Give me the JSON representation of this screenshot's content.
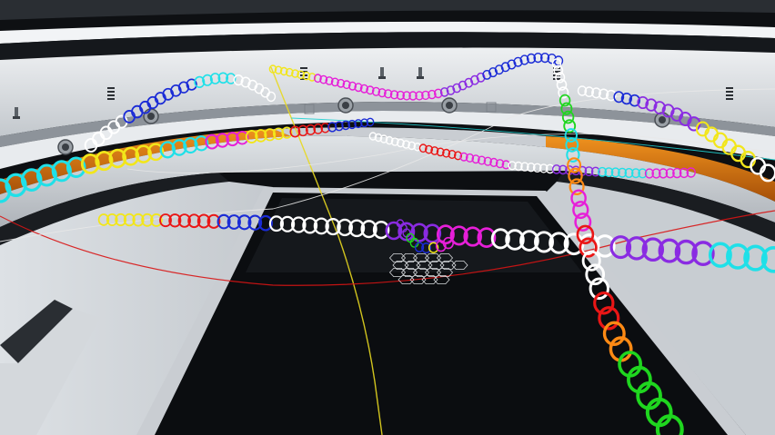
{
  "colors": {
    "ceiling": "#0e1013",
    "wall_light": "#d9dde1",
    "wall_mid": "#b4b9bf",
    "wall_dark": "#6c7279",
    "trim_white": "#f2f4f6",
    "orange_band": "#e07a10",
    "floor": "#0b0d10",
    "pit_rim": "#c9cdd2",
    "ring_white": "#ffffff",
    "ring_cyan": "#1fe0e8",
    "ring_magenta": "#e61fd8",
    "ring_purple": "#8a2be2",
    "ring_blue": "#1a2bd6",
    "ring_red": "#ea1616",
    "ring_yellow": "#f2e61a",
    "ring_orange": "#ff8a14",
    "ring_green": "#1fd61f",
    "trail_yellow": "#e8d820",
    "trail_red": "#d81414",
    "trail_white": "#e8e8e8",
    "trail_cyan": "#20d0d0"
  },
  "icons": [
    "wall-vent-icon",
    "wall-speaker-icon",
    "wall-lamp-icon",
    "hex-grid-target-icon"
  ]
}
